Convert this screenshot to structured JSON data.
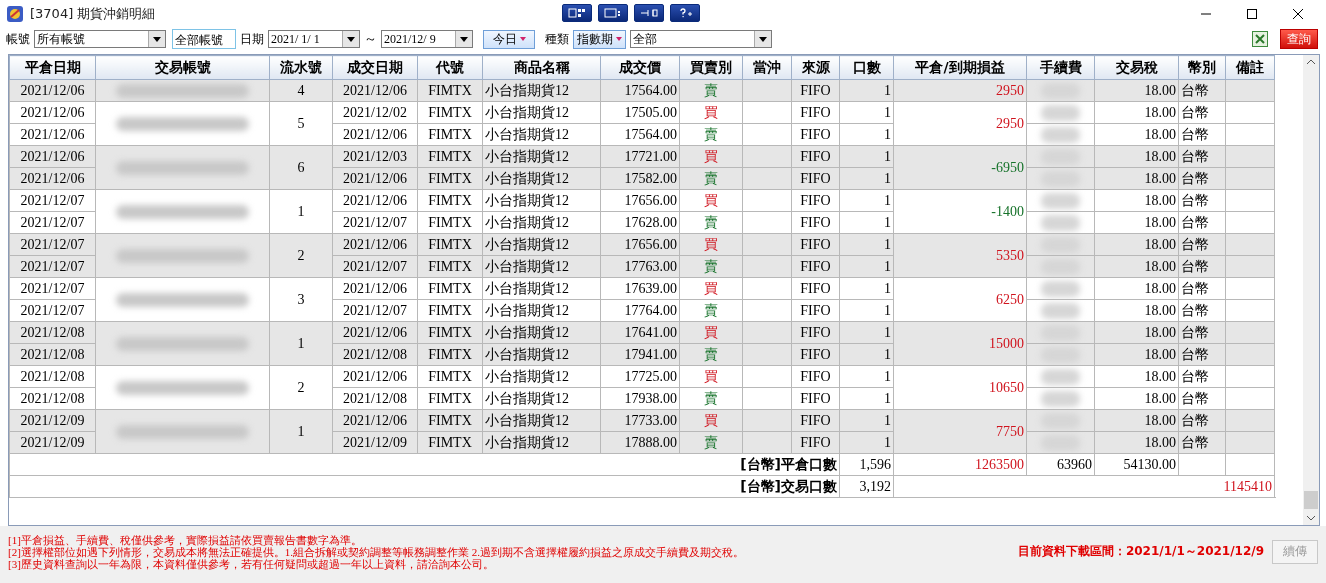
{
  "window": {
    "title": "[3704] 期貨沖銷明細"
  },
  "filters": {
    "account_label": "帳號",
    "account_value": "所有帳號",
    "account_name": "全部帳號",
    "date_label": "日期",
    "date_from": "2021/ 1/ 1",
    "date_sep": "～",
    "date_to": "2021/12/ 9",
    "today_button": "今日",
    "type_label": "種類",
    "type_button": "指數期",
    "type_value": "全部",
    "query_button": "查詢"
  },
  "table": {
    "columns": [
      "平倉日期",
      "交易帳號",
      "流水號",
      "成交日期",
      "代號",
      "商品名稱",
      "成交價",
      "買賣別",
      "當沖",
      "來源",
      "口數",
      "平倉/到期損益",
      "手續費",
      "交易稅",
      "幣別",
      "備註"
    ],
    "groups": [
      {
        "seq": "4",
        "pnl": "2950",
        "profit": true,
        "rows": [
          {
            "close_date": "2021/12/06",
            "trade_date": "2021/12/06",
            "code": "FIMTX",
            "product": "小台指期貨12",
            "price": "17564.00",
            "side": "賣",
            "kind": "sell",
            "source": "FIFO",
            "qty": "1",
            "tax": "18.00",
            "currency": "台幣"
          }
        ]
      },
      {
        "seq": "5",
        "pnl": "2950",
        "profit": true,
        "rows": [
          {
            "close_date": "2021/12/06",
            "trade_date": "2021/12/02",
            "code": "FIMTX",
            "product": "小台指期貨12",
            "price": "17505.00",
            "side": "買",
            "kind": "buy",
            "source": "FIFO",
            "qty": "1",
            "tax": "18.00",
            "currency": "台幣"
          },
          {
            "close_date": "2021/12/06",
            "trade_date": "2021/12/06",
            "code": "FIMTX",
            "product": "小台指期貨12",
            "price": "17564.00",
            "side": "賣",
            "kind": "sell",
            "source": "FIFO",
            "qty": "1",
            "tax": "18.00",
            "currency": "台幣"
          }
        ]
      },
      {
        "seq": "6",
        "pnl": "-6950",
        "profit": false,
        "rows": [
          {
            "close_date": "2021/12/06",
            "trade_date": "2021/12/03",
            "code": "FIMTX",
            "product": "小台指期貨12",
            "price": "17721.00",
            "side": "買",
            "kind": "buy",
            "source": "FIFO",
            "qty": "1",
            "tax": "18.00",
            "currency": "台幣"
          },
          {
            "close_date": "2021/12/06",
            "trade_date": "2021/12/06",
            "code": "FIMTX",
            "product": "小台指期貨12",
            "price": "17582.00",
            "side": "賣",
            "kind": "sell",
            "source": "FIFO",
            "qty": "1",
            "tax": "18.00",
            "currency": "台幣"
          }
        ]
      },
      {
        "seq": "1",
        "pnl": "-1400",
        "profit": false,
        "rows": [
          {
            "close_date": "2021/12/07",
            "trade_date": "2021/12/06",
            "code": "FIMTX",
            "product": "小台指期貨12",
            "price": "17656.00",
            "side": "買",
            "kind": "buy",
            "source": "FIFO",
            "qty": "1",
            "tax": "18.00",
            "currency": "台幣"
          },
          {
            "close_date": "2021/12/07",
            "trade_date": "2021/12/07",
            "code": "FIMTX",
            "product": "小台指期貨12",
            "price": "17628.00",
            "side": "賣",
            "kind": "sell",
            "source": "FIFO",
            "qty": "1",
            "tax": "18.00",
            "currency": "台幣"
          }
        ]
      },
      {
        "seq": "2",
        "pnl": "5350",
        "profit": true,
        "rows": [
          {
            "close_date": "2021/12/07",
            "trade_date": "2021/12/06",
            "code": "FIMTX",
            "product": "小台指期貨12",
            "price": "17656.00",
            "side": "買",
            "kind": "buy",
            "source": "FIFO",
            "qty": "1",
            "tax": "18.00",
            "currency": "台幣"
          },
          {
            "close_date": "2021/12/07",
            "trade_date": "2021/12/07",
            "code": "FIMTX",
            "product": "小台指期貨12",
            "price": "17763.00",
            "side": "賣",
            "kind": "sell",
            "source": "FIFO",
            "qty": "1",
            "tax": "18.00",
            "currency": "台幣"
          }
        ]
      },
      {
        "seq": "3",
        "pnl": "6250",
        "profit": true,
        "rows": [
          {
            "close_date": "2021/12/07",
            "trade_date": "2021/12/06",
            "code": "FIMTX",
            "product": "小台指期貨12",
            "price": "17639.00",
            "side": "買",
            "kind": "buy",
            "source": "FIFO",
            "qty": "1",
            "tax": "18.00",
            "currency": "台幣"
          },
          {
            "close_date": "2021/12/07",
            "trade_date": "2021/12/07",
            "code": "FIMTX",
            "product": "小台指期貨12",
            "price": "17764.00",
            "side": "賣",
            "kind": "sell",
            "source": "FIFO",
            "qty": "1",
            "tax": "18.00",
            "currency": "台幣"
          }
        ]
      },
      {
        "seq": "1",
        "pnl": "15000",
        "profit": true,
        "rows": [
          {
            "close_date": "2021/12/08",
            "trade_date": "2021/12/06",
            "code": "FIMTX",
            "product": "小台指期貨12",
            "price": "17641.00",
            "side": "買",
            "kind": "buy",
            "source": "FIFO",
            "qty": "1",
            "tax": "18.00",
            "currency": "台幣"
          },
          {
            "close_date": "2021/12/08",
            "trade_date": "2021/12/08",
            "code": "FIMTX",
            "product": "小台指期貨12",
            "price": "17941.00",
            "side": "賣",
            "kind": "sell",
            "source": "FIFO",
            "qty": "1",
            "tax": "18.00",
            "currency": "台幣"
          }
        ]
      },
      {
        "seq": "2",
        "pnl": "10650",
        "profit": true,
        "rows": [
          {
            "close_date": "2021/12/08",
            "trade_date": "2021/12/06",
            "code": "FIMTX",
            "product": "小台指期貨12",
            "price": "17725.00",
            "side": "買",
            "kind": "buy",
            "source": "FIFO",
            "qty": "1",
            "tax": "18.00",
            "currency": "台幣"
          },
          {
            "close_date": "2021/12/08",
            "trade_date": "2021/12/08",
            "code": "FIMTX",
            "product": "小台指期貨12",
            "price": "17938.00",
            "side": "賣",
            "kind": "sell",
            "source": "FIFO",
            "qty": "1",
            "tax": "18.00",
            "currency": "台幣"
          }
        ]
      },
      {
        "seq": "1",
        "pnl": "7750",
        "profit": true,
        "rows": [
          {
            "close_date": "2021/12/09",
            "trade_date": "2021/12/06",
            "code": "FIMTX",
            "product": "小台指期貨12",
            "price": "17733.00",
            "side": "買",
            "kind": "buy",
            "source": "FIFO",
            "qty": "1",
            "tax": "18.00",
            "currency": "台幣"
          },
          {
            "close_date": "2021/12/09",
            "trade_date": "2021/12/09",
            "code": "FIMTX",
            "product": "小台指期貨12",
            "price": "17888.00",
            "side": "賣",
            "kind": "sell",
            "source": "FIFO",
            "qty": "1",
            "tax": "18.00",
            "currency": "台幣"
          }
        ]
      }
    ],
    "summary": {
      "close_label": "[台幣]平倉口數",
      "close_qty": "1,596",
      "close_pnl": "1263500",
      "close_fee": "63960",
      "close_tax": "54130.00",
      "trade_label": "[台幣]交易口數",
      "trade_qty": "3,192",
      "net": "1145410"
    }
  },
  "notes": [
    "[1]平倉損益、手續費、稅僅供參考，實際損益請依買賣報告書數字為準。",
    "[2]選擇權部位如遇下列情形，交易成本將無法正確提供。1.組合拆解或契約調整等帳務調整作業 2.過到期不含選擇權履約損益之原成交手續費及期交稅。",
    "[3]歷史資料查詢以一年為限，本資料僅供參考，若有任何疑問或超過一年以上資料，請洽詢本公司。"
  ],
  "download_range": "目前資料下載區間：2021/1/1～2021/12/9",
  "resume_button": {
    "label": "續傳",
    "disabled": true
  }
}
